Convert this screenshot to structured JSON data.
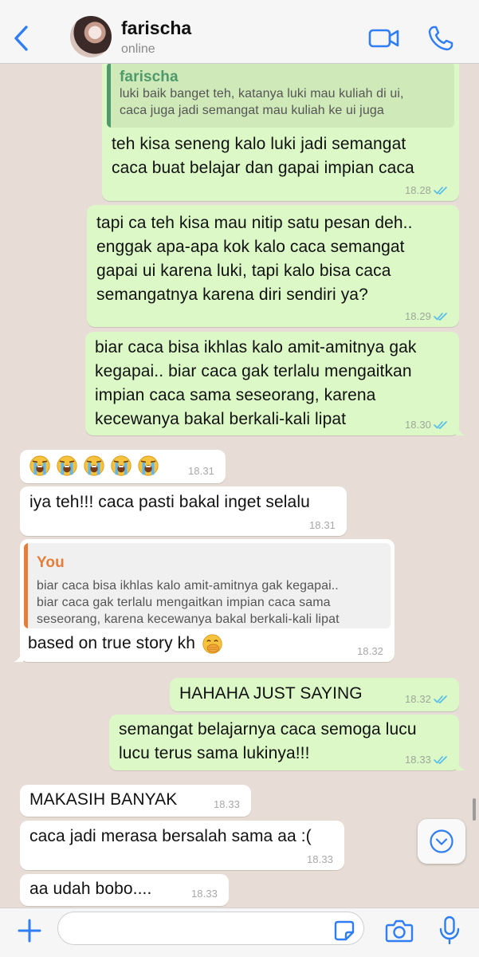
{
  "header": {
    "contact_name": "farischa",
    "status": "online"
  },
  "colors": {
    "accent": "#2f7ef6",
    "outgoing_bubble": "#dbf8c6",
    "incoming_bubble": "#ffffff",
    "chat_background": "#e7ddd6",
    "quote_name_contact": "#4f9a6b",
    "quote_name_you": "#e67e3a",
    "read_ticks": "#53bdeb"
  },
  "icons": {
    "back": "chevron-left-icon",
    "video": "video-camera-icon",
    "call": "phone-icon",
    "plus": "plus-icon",
    "sticker": "sticker-icon",
    "camera": "camera-icon",
    "mic": "microphone-icon",
    "scroll_down": "chevron-down-circle-icon",
    "read_receipt": "double-check-icon",
    "emoji_crying": "loudly-crying-face",
    "emoji_hand_over_mouth": "face-with-hand-over-mouth"
  },
  "messages": [
    {
      "direction": "out",
      "quote": {
        "name": "farischa",
        "text": "luki baik banget teh, katanya luki mau kuliah di ui,\ncaca juga jadi semangat mau kuliah ke ui juga"
      },
      "text": "teh kisa seneng kalo luki jadi semangat\ncaca buat belajar dan gapai impian caca",
      "time": "18.28"
    },
    {
      "direction": "out",
      "text": "tapi ca teh kisa mau nitip satu pesan deh..\nenggak apa-apa kok kalo caca semangat\ngapai ui karena luki, tapi kalo bisa caca\nsemangatnya karena diri sendiri ya?",
      "time": "18.29"
    },
    {
      "direction": "out",
      "text": "biar caca bisa ikhlas kalo amit-amitnya gak\nkegapai.. biar caca gak terlalu mengaitkan\nimpian caca sama seseorang, karena\nkecewanya bakal berkali-kali lipat",
      "time": "18.30"
    },
    {
      "direction": "in",
      "emoji_count": 5,
      "time": "18.31"
    },
    {
      "direction": "in",
      "text": "iya teh!!! caca pasti bakal inget selalu",
      "time": "18.31"
    },
    {
      "direction": "in",
      "quote": {
        "name": "You",
        "text": "biar caca bisa ikhlas kalo amit-amitnya gak kegapai..\nbiar caca gak terlalu mengaitkan impian caca sama\nseseorang, karena kecewanya bakal berkali-kali lipat"
      },
      "text": "based on true story kh",
      "time": "18.32"
    },
    {
      "direction": "out",
      "text": "HAHAHA JUST SAYING",
      "time": "18.32"
    },
    {
      "direction": "out",
      "text": "semangat belajarnya caca semoga lucu\nlucu terus sama lukinya!!!",
      "time": "18.33"
    },
    {
      "direction": "in",
      "text": "MAKASIH BANYAK",
      "time": "18.33"
    },
    {
      "direction": "in",
      "text": "caca jadi merasa bersalah sama aa :(",
      "time": "18.33"
    },
    {
      "direction": "in",
      "text": "aa udah bobo....",
      "time": "18.33"
    }
  ],
  "composer": {
    "value": "",
    "placeholder": ""
  }
}
